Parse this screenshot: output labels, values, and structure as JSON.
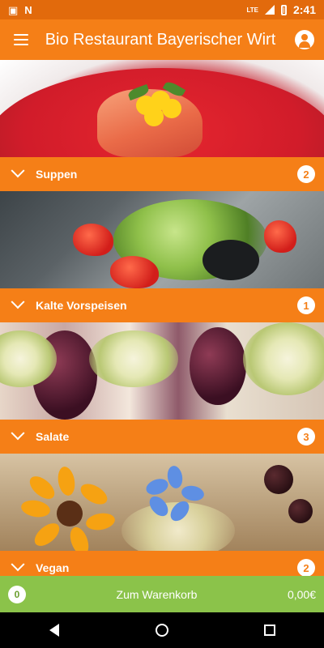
{
  "status_bar": {
    "time": "2:41",
    "network": "LTE",
    "icons": [
      "photo-icon",
      "n-icon",
      "signal-icon",
      "battery-icon"
    ]
  },
  "app_bar": {
    "title": "Bio Restaurant Bayerischer Wirt",
    "menu_icon": "hamburger-icon",
    "profile_icon": "account-icon"
  },
  "categories": [
    {
      "label": "Suppen",
      "count": "2",
      "image": "soup-image"
    },
    {
      "label": "Kalte Vorspeisen",
      "count": "1",
      "image": "salad-starter-image"
    },
    {
      "label": "Salate",
      "count": "3",
      "image": "salad-rolls-image"
    },
    {
      "label": "Vegan",
      "count": "2",
      "image": "vegan-dish-image"
    }
  ],
  "cart": {
    "count": "0",
    "label": "Zum Warenkorb",
    "total": "0,00€"
  },
  "colors": {
    "accent": "#f57f17",
    "status_bar": "#e26a0c",
    "cart": "#8bc34a"
  }
}
